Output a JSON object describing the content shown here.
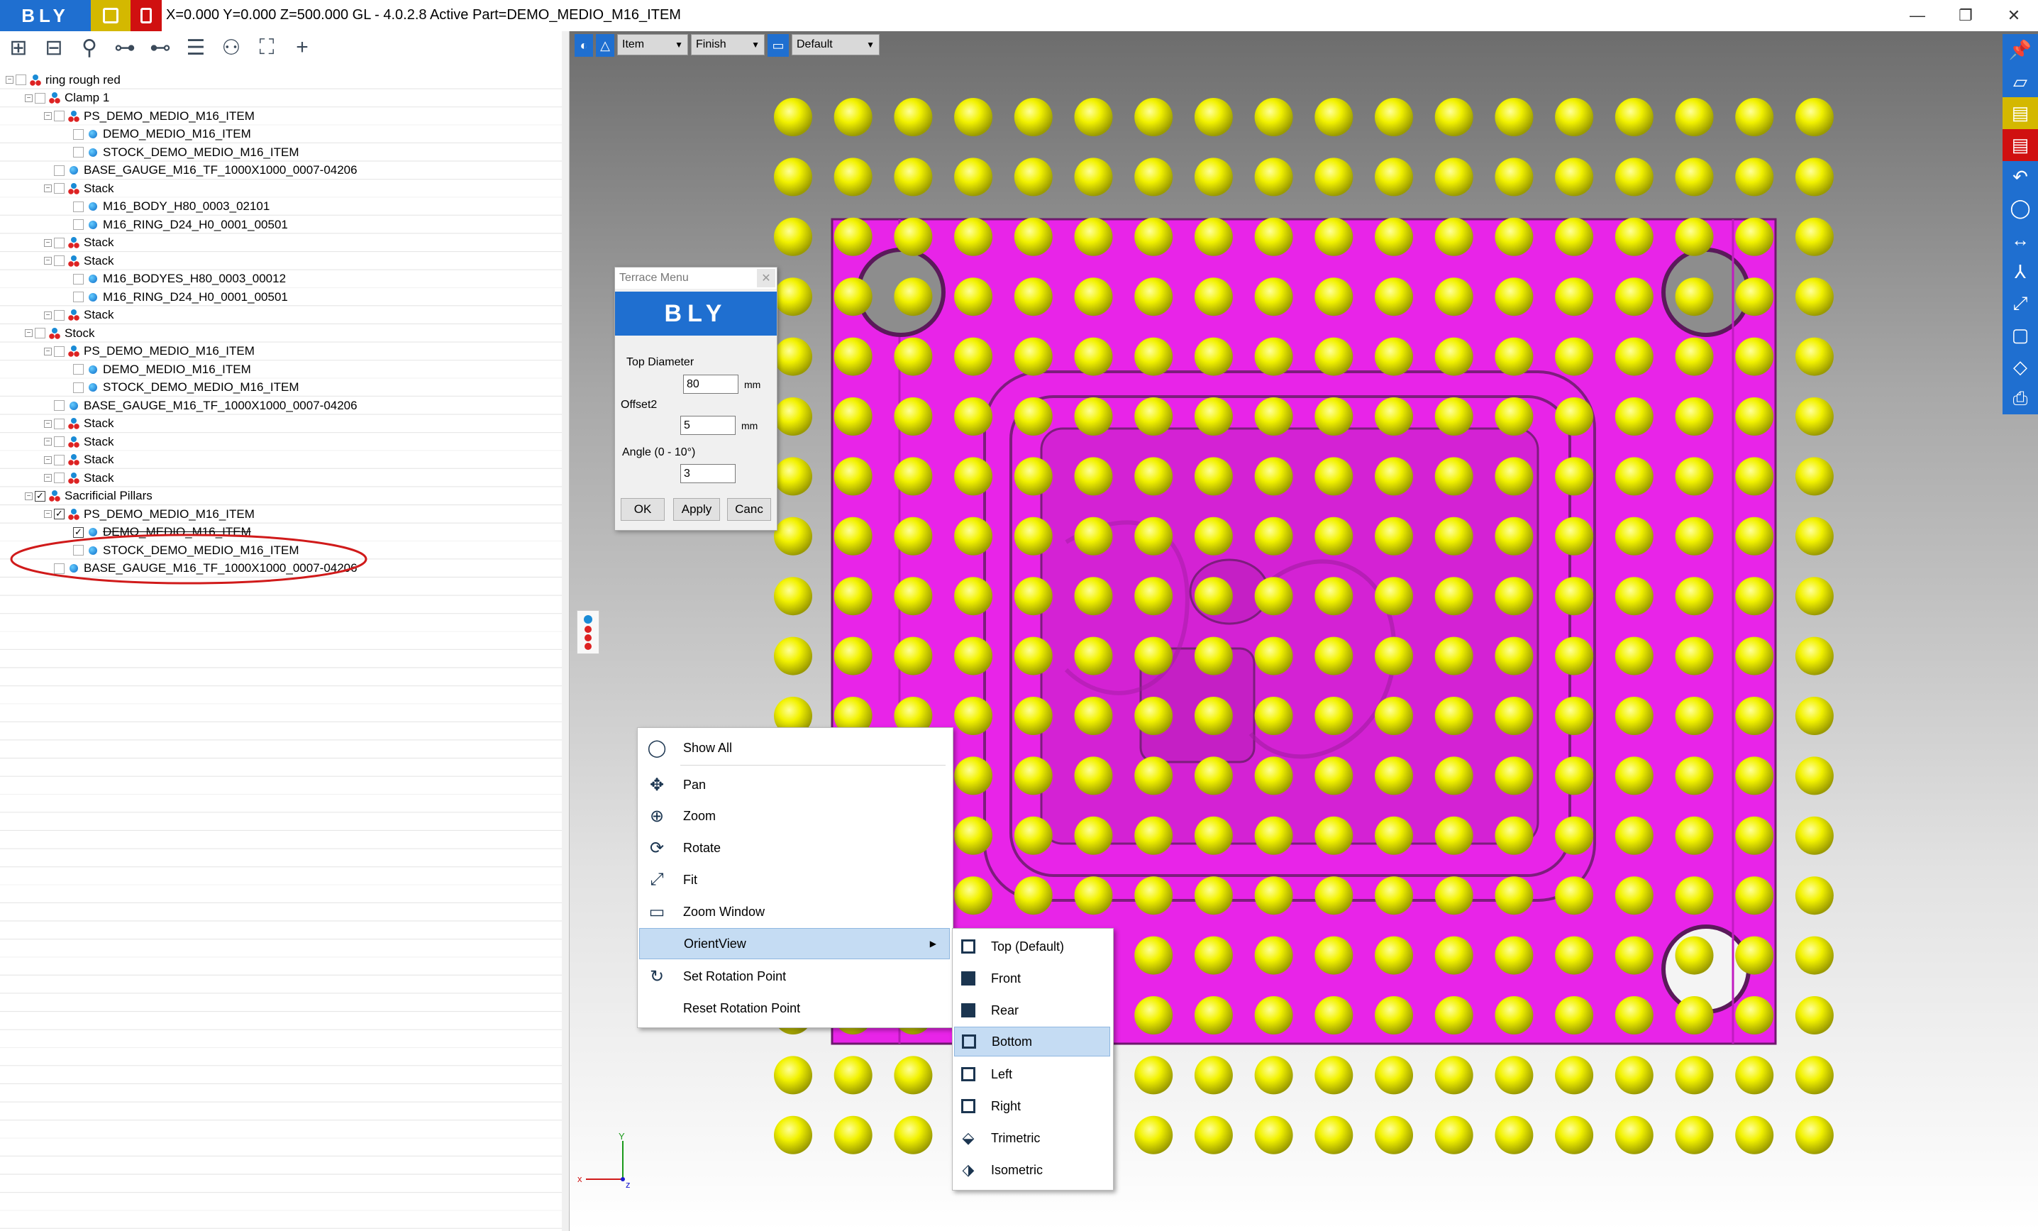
{
  "titlebar": {
    "logo": "BLY",
    "status": "X=0.000 Y=0.000 Z=500.000    GL - 4.0.2.8 Active Part=DEMO_MEDIO_M16_ITEM",
    "minimize": "—",
    "restore": "❐",
    "close": "✕"
  },
  "toolbar": {
    "icons": [
      "expand-icon",
      "collapse-icon",
      "search-icon",
      "tree-icon",
      "tree-alt-icon",
      "list-icon",
      "people-icon",
      "fit-icon",
      "plus-icon"
    ]
  },
  "tree": {
    "items": [
      {
        "label": "ring rough red",
        "indent": 0,
        "icon": "assembly",
        "checked": false
      },
      {
        "label": "Clamp 1",
        "indent": 1,
        "icon": "assembly",
        "checked": false
      },
      {
        "label": "PS_DEMO_MEDIO_M16_ITEM",
        "indent": 2,
        "icon": "assembly",
        "checked": false
      },
      {
        "label": "DEMO_MEDIO_M16_ITEM",
        "indent": 3,
        "icon": "part",
        "checked": false
      },
      {
        "label": "STOCK_DEMO_MEDIO_M16_ITEM",
        "indent": 3,
        "icon": "part",
        "checked": false
      },
      {
        "label": "BASE_GAUGE_M16_TF_1000X1000_0007-04206",
        "indent": 2,
        "icon": "part",
        "checked": false
      },
      {
        "label": "Stack",
        "indent": 2,
        "icon": "assembly",
        "checked": false
      },
      {
        "label": "M16_BODY_H80_0003_02101",
        "indent": 3,
        "icon": "part",
        "checked": false
      },
      {
        "label": "M16_RING_D24_H0_0001_00501",
        "indent": 3,
        "icon": "part",
        "checked": false
      },
      {
        "label": "Stack",
        "indent": 2,
        "icon": "assembly",
        "checked": false
      },
      {
        "label": "Stack",
        "indent": 2,
        "icon": "assembly",
        "checked": false
      },
      {
        "label": "M16_BODYES_H80_0003_00012",
        "indent": 3,
        "icon": "part",
        "checked": false
      },
      {
        "label": "M16_RING_D24_H0_0001_00501",
        "indent": 3,
        "icon": "part",
        "checked": false
      },
      {
        "label": "Stack",
        "indent": 2,
        "icon": "assembly",
        "checked": false
      },
      {
        "label": "Stock",
        "indent": 1,
        "icon": "assembly",
        "checked": false
      },
      {
        "label": "PS_DEMO_MEDIO_M16_ITEM",
        "indent": 2,
        "icon": "assembly",
        "checked": false
      },
      {
        "label": "DEMO_MEDIO_M16_ITEM",
        "indent": 3,
        "icon": "part",
        "checked": false
      },
      {
        "label": "STOCK_DEMO_MEDIO_M16_ITEM",
        "indent": 3,
        "icon": "part",
        "checked": false
      },
      {
        "label": "BASE_GAUGE_M16_TF_1000X1000_0007-04206",
        "indent": 2,
        "icon": "part",
        "checked": false
      },
      {
        "label": "Stack",
        "indent": 2,
        "icon": "assembly",
        "checked": false
      },
      {
        "label": "Stack",
        "indent": 2,
        "icon": "assembly",
        "checked": false
      },
      {
        "label": "Stack",
        "indent": 2,
        "icon": "assembly",
        "checked": false
      },
      {
        "label": "Stack",
        "indent": 2,
        "icon": "assembly",
        "checked": false
      },
      {
        "label": "Sacrificial Pillars",
        "indent": 1,
        "icon": "assembly",
        "checked": true
      },
      {
        "label": "PS_DEMO_MEDIO_M16_ITEM",
        "indent": 2,
        "icon": "assembly",
        "checked": true
      },
      {
        "label": "DEMO_MEDIO_M16_ITEM",
        "indent": 3,
        "icon": "part",
        "checked": true,
        "strike": true
      },
      {
        "label": "STOCK_DEMO_MEDIO_M16_ITEM",
        "indent": 3,
        "icon": "part",
        "checked": false
      },
      {
        "label": "BASE_GAUGE_M16_TF_1000X1000_0007-04206",
        "indent": 2,
        "icon": "part",
        "checked": false
      }
    ]
  },
  "viewport": {
    "item_select": "Item",
    "finish_select": "Finish",
    "default_select": "Default",
    "axis_x": "x",
    "axis_y": "Y",
    "axis_z": "z"
  },
  "terrace": {
    "title": "Terrace Menu",
    "close": "✕",
    "logo": "BLY",
    "top_diameter_label": "Top Diameter",
    "top_diameter_value": "80",
    "top_diameter_unit": "mm",
    "offset_label": "Offset2",
    "offset_value": "5",
    "offset_unit": "mm",
    "angle_label": "Angle (0 - 10°)",
    "angle_value": "3",
    "ok": "OK",
    "apply": "Apply",
    "cancel": "Canc"
  },
  "context_menu": {
    "items": [
      {
        "label": "Show All",
        "icon": "bulb-icon"
      },
      {
        "label": "Pan",
        "icon": "pan-icon"
      },
      {
        "label": "Zoom",
        "icon": "zoom-icon"
      },
      {
        "label": "Rotate",
        "icon": "rotate-icon"
      },
      {
        "label": "Fit",
        "icon": "fit-icon"
      },
      {
        "label": "Zoom Window",
        "icon": "zoom-window-icon"
      },
      {
        "label": "OrientView",
        "icon": "",
        "submenu": true
      },
      {
        "label": "Set Rotation Point",
        "icon": "rotation-point-icon"
      },
      {
        "label": "Reset Rotation Point",
        "icon": ""
      }
    ]
  },
  "orient_submenu": {
    "items": [
      "Top (Default)",
      "Front",
      "Rear",
      "Bottom",
      "Left",
      "Right",
      "Trimetric",
      "Isometric"
    ],
    "selected": "Bottom"
  },
  "colors": {
    "accent": "#1f6fd0",
    "plate": "#e824e8",
    "sphere": "#f2f200",
    "highlight_circle": "#d01a1a"
  }
}
